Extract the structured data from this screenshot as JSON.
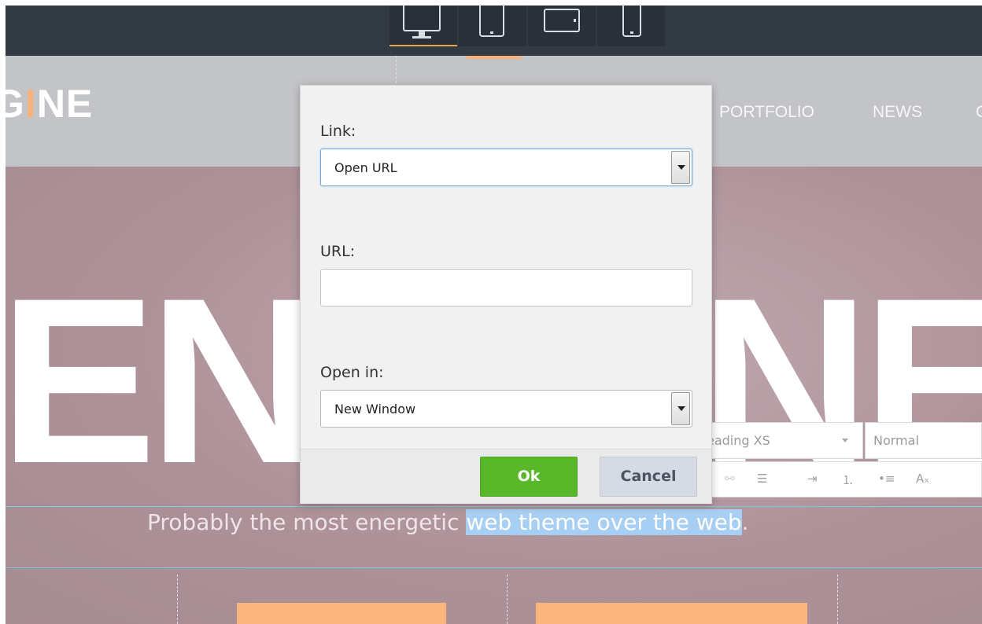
{
  "device_bar": {
    "devices": [
      {
        "name": "desktop",
        "icon": "desktop-monitor-icon",
        "active": true
      },
      {
        "name": "tablet-portrait",
        "icon": "tablet-portrait-icon",
        "active": false
      },
      {
        "name": "tablet-landscape",
        "icon": "tablet-landscape-icon",
        "active": false
      },
      {
        "name": "phone",
        "icon": "phone-icon",
        "active": false
      }
    ],
    "accent_color": "#e8a64f"
  },
  "site": {
    "logo": {
      "prefix": "G",
      "accent": "I",
      "suffix": "NE"
    },
    "nav": [
      "PORTFOLIO",
      "NEWS",
      "C"
    ],
    "hero_left": "EN",
    "hero_right": "NE",
    "tagline_plain": "Probably the most energetic ",
    "tagline_selected": "web theme over the web",
    "tagline_end": "."
  },
  "editor_toolbar": {
    "style_combo": "eading XS",
    "format_combo": "Normal",
    "tools": [
      "unlink-icon",
      "align-left-icon",
      "indent-icon",
      "numbered-list-icon",
      "bulleted-list-icon",
      "clear-format-icon"
    ],
    "clear_format_glyph": "Aₓ"
  },
  "dialog": {
    "link_label": "Link:",
    "link_value": "Open URL",
    "url_label": "URL:",
    "url_value": "",
    "open_in_label": "Open in:",
    "open_in_value": "New Window",
    "ok_label": "Ok",
    "cancel_label": "Cancel",
    "ok_color": "#58b82a",
    "cancel_color": "#d5dae4"
  }
}
